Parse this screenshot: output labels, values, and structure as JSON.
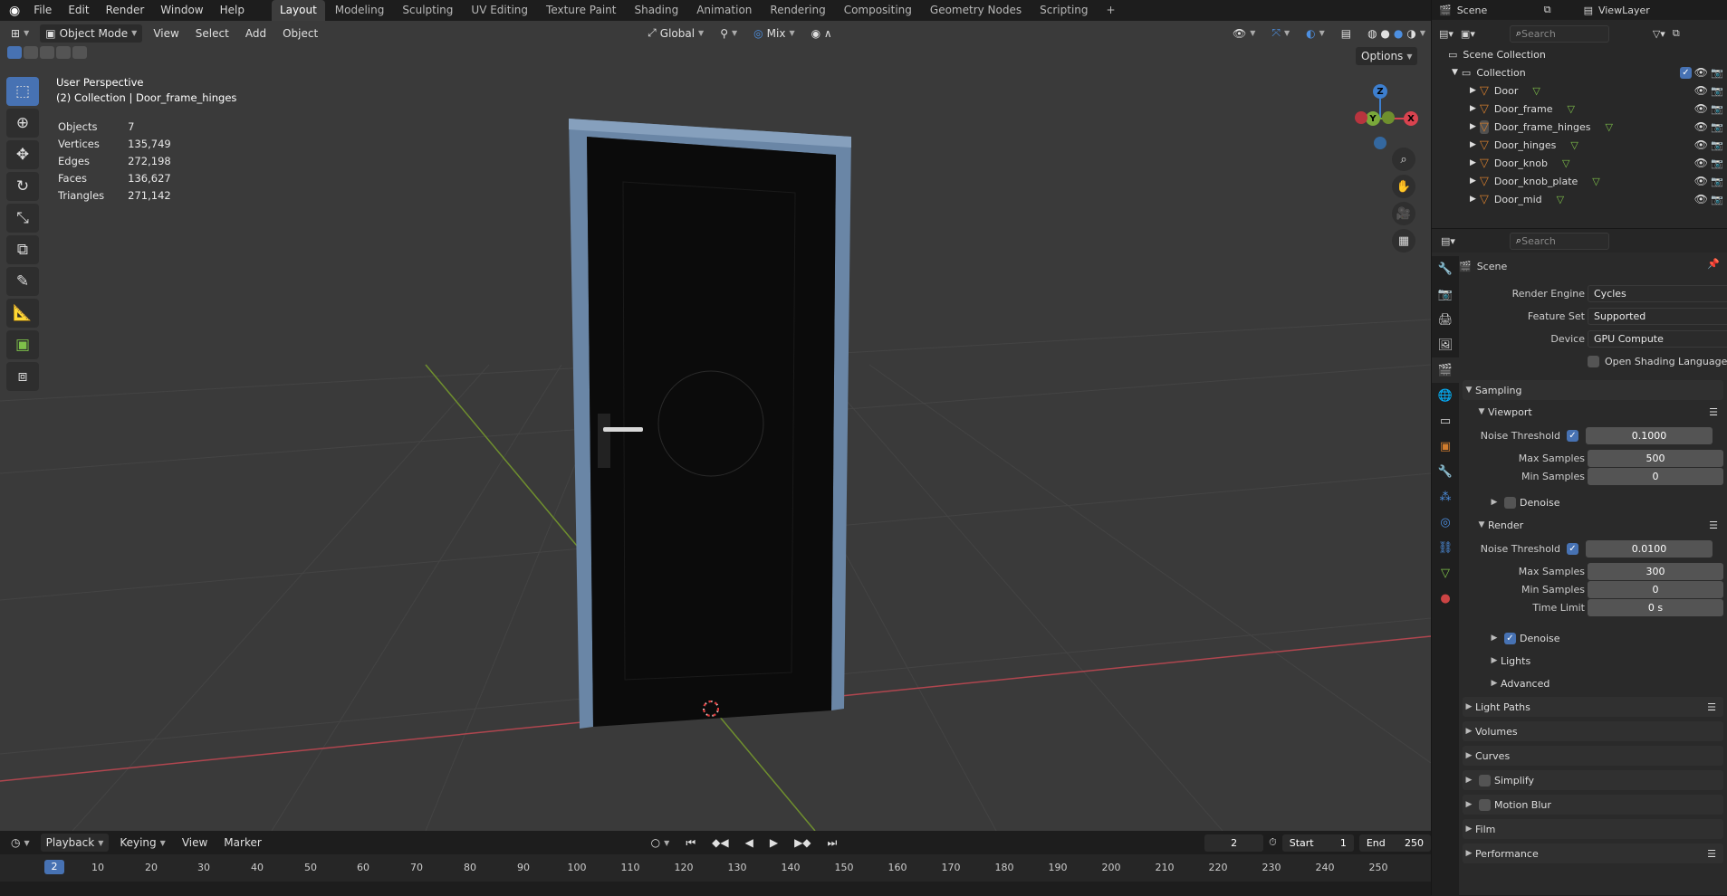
{
  "topbar": {
    "menus": [
      "File",
      "Edit",
      "Render",
      "Window",
      "Help"
    ],
    "workspaces": [
      "Layout",
      "Modeling",
      "Sculpting",
      "UV Editing",
      "Texture Paint",
      "Shading",
      "Animation",
      "Rendering",
      "Compositing",
      "Geometry Nodes",
      "Scripting"
    ],
    "active_workspace": "Layout",
    "add_tab": "+"
  },
  "viewport": {
    "mode": "Object Mode",
    "menus": [
      "View",
      "Select",
      "Add",
      "Object"
    ],
    "transform_orientation": "Global",
    "snap_mode": "Mix",
    "options": "Options",
    "perspective_label": "User Perspective",
    "collection_label": "(2) Collection | Door_frame_hinges",
    "stats": [
      {
        "label": "Objects",
        "value": "7"
      },
      {
        "label": "Vertices",
        "value": "135,749"
      },
      {
        "label": "Edges",
        "value": "272,198"
      },
      {
        "label": "Faces",
        "value": "136,627"
      },
      {
        "label": "Triangles",
        "value": "271,142"
      }
    ],
    "gizmo": {
      "z": "Z",
      "y": "Y",
      "x": "X"
    },
    "colors": {
      "x_axis": "#d9434f",
      "y_axis": "#7aa83a",
      "z_axis": "#3d7fcf",
      "door_frame": "#6a86a6",
      "door": "#0b0b0b",
      "selection": "#4772b3"
    }
  },
  "timeline": {
    "menus": [
      "Playback",
      "Keying",
      "View",
      "Marker"
    ],
    "current_frame": "2",
    "start_label": "Start",
    "start": "1",
    "end_label": "End",
    "end": "250",
    "ticks": [
      "10",
      "20",
      "30",
      "40",
      "50",
      "60",
      "70",
      "80",
      "90",
      "100",
      "110",
      "120",
      "130",
      "140",
      "150",
      "160",
      "170",
      "180",
      "190",
      "200",
      "210",
      "220",
      "230",
      "240",
      "250"
    ]
  },
  "outliner": {
    "scene": "Scene",
    "view_layer": "ViewLayer",
    "search_placeholder": "Search",
    "root": "Scene Collection",
    "collection": "Collection",
    "objects": [
      "Door",
      "Door_frame",
      "Door_frame_hinges",
      "Door_hinges",
      "Door_knob",
      "Door_knob_plate",
      "Door_mid"
    ]
  },
  "properties": {
    "search_placeholder": "Search",
    "context": "Scene",
    "render_engine_label": "Render Engine",
    "render_engine": "Cycles",
    "feature_set_label": "Feature Set",
    "feature_set": "Supported",
    "device_label": "Device",
    "device": "GPU Compute",
    "osl_label": "Open Shading Language",
    "sampling": "Sampling",
    "viewport": "Viewport",
    "vp_noise_label": "Noise Threshold",
    "vp_noise": "0.1000",
    "vp_max_label": "Max Samples",
    "vp_max": "500",
    "vp_min_label": "Min Samples",
    "vp_min": "0",
    "vp_denoise": "Denoise",
    "render": "Render",
    "r_noise_label": "Noise Threshold",
    "r_noise": "0.0100",
    "r_max_label": "Max Samples",
    "r_max": "300",
    "r_min_label": "Min Samples",
    "r_min": "0",
    "r_time_label": "Time Limit",
    "r_time": "0 s",
    "r_denoise": "Denoise",
    "lights": "Lights",
    "advanced": "Advanced",
    "panels": [
      "Light Paths",
      "Volumes",
      "Curves",
      "Simplify",
      "Motion Blur",
      "Film",
      "Performance"
    ]
  }
}
